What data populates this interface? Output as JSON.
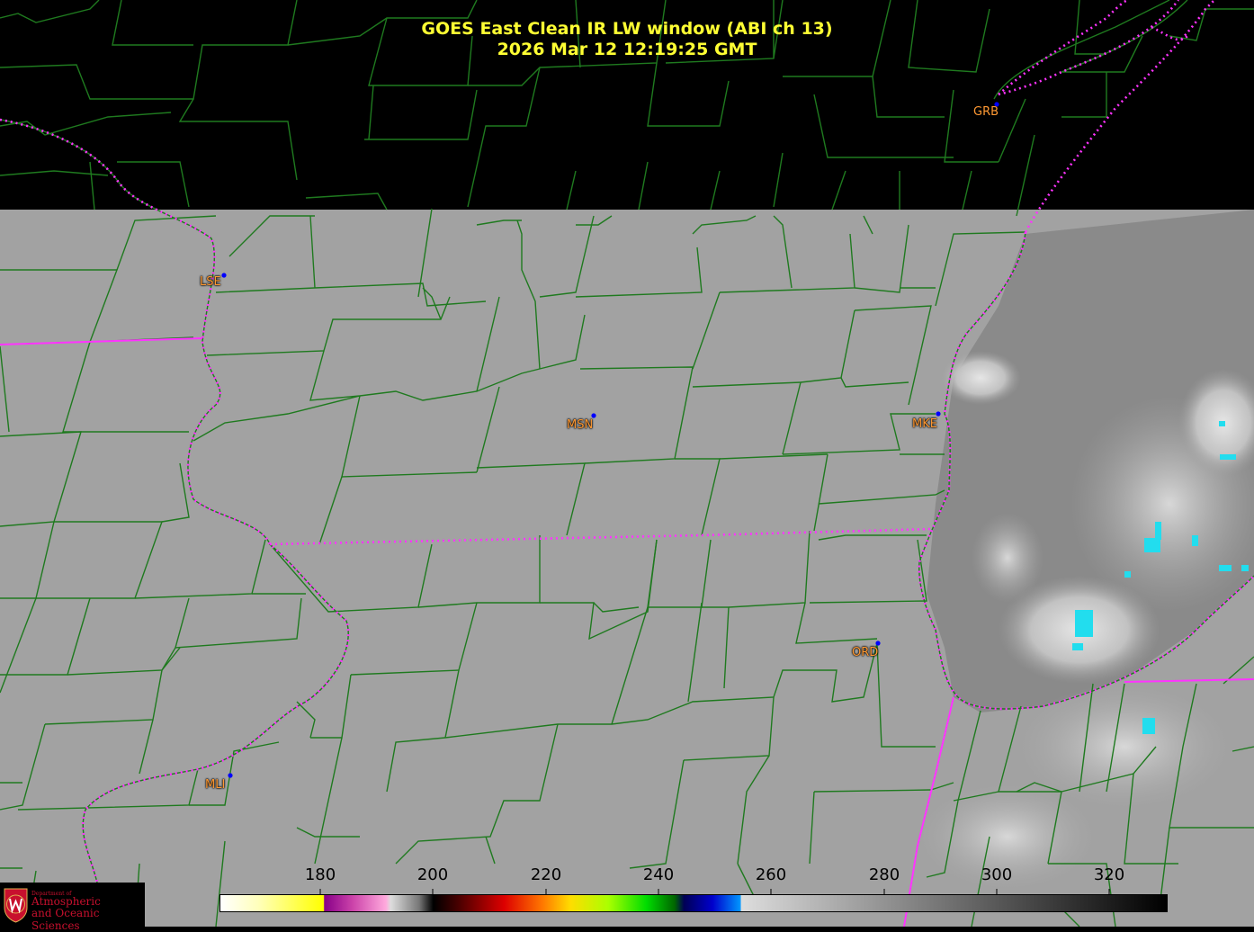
{
  "title": {
    "line1": "GOES East Clean IR LW window (ABI ch 13)",
    "line2": "2026 Mar 12  12:19:25 GMT"
  },
  "stations": [
    {
      "id": "GRB"
    },
    {
      "id": "LSE"
    },
    {
      "id": "MSN"
    },
    {
      "id": "MKE"
    },
    {
      "id": "ORD"
    },
    {
      "id": "MLI"
    }
  ],
  "colorbar": {
    "ticks": [
      "180",
      "200",
      "220",
      "240",
      "260",
      "280",
      "300",
      "320"
    ],
    "range": [
      163,
      331
    ],
    "units_shown": "none"
  },
  "logo": {
    "small_text": "Department of",
    "line1": "Atmospheric",
    "line2": "and Oceanic Sciences"
  },
  "colors": {
    "title": "#ffff33",
    "county_lines": "#1f7a1f",
    "state_lines": "#ff33ff",
    "station_label": "#ff9933",
    "station_dot": "#0000ff",
    "logo": "#c8102e"
  }
}
